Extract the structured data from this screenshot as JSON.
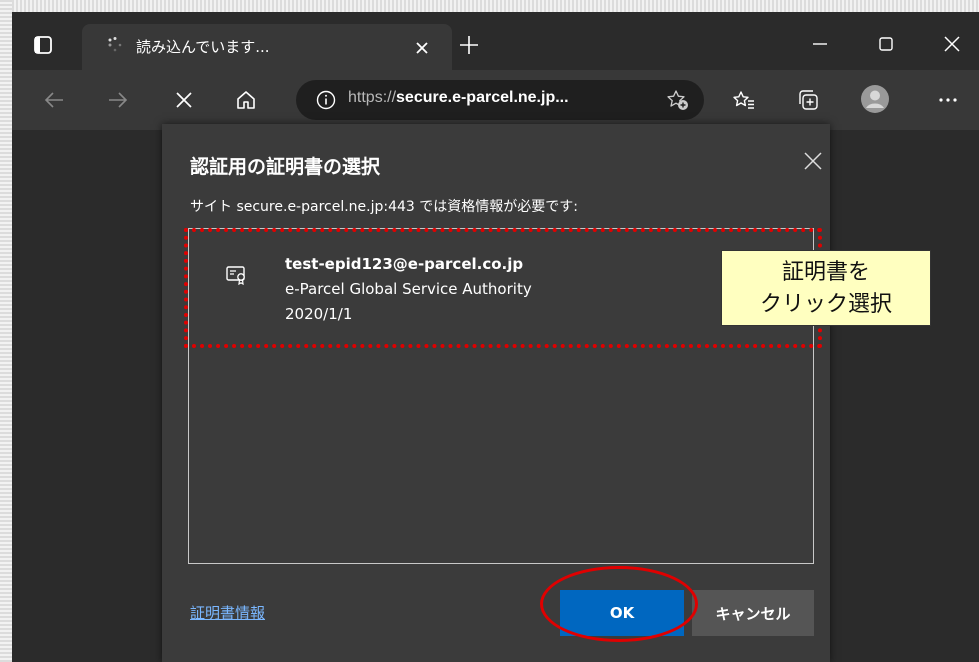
{
  "tab": {
    "title": "読み込んでいます..."
  },
  "address_bar": {
    "scheme": "https://",
    "host": "secure.e-parcel.ne.jp..."
  },
  "dialog": {
    "title": "認証用の証明書の選択",
    "message": "サイト secure.e-parcel.ne.jp:443 では資格情報が必要です:",
    "certificates": [
      {
        "name": "test-epid123@e-parcel.co.jp",
        "issuer": "e-Parcel Global Service Authority",
        "date": "2020/1/1"
      }
    ],
    "cert_info_link": "証明書情報",
    "ok_label": "OK",
    "cancel_label": "キャンセル"
  },
  "annotation": {
    "callout_line1": "証明書を",
    "callout_line2": "クリック選択"
  },
  "icons": {
    "tab_actions": "tab-actions-icon",
    "spinner": "loading-icon",
    "tab_close": "close-icon",
    "new_tab": "plus-icon",
    "minimize": "minimize-icon",
    "maximize": "maximize-icon",
    "window_close": "close-icon",
    "back": "arrow-left-icon",
    "forward": "arrow-right-icon",
    "stop": "stop-icon",
    "home": "home-icon",
    "info": "info-icon",
    "add_favorite": "star-add-icon",
    "favorites": "favorites-icon",
    "collections": "collections-icon",
    "profile": "profile-icon",
    "more": "more-icon",
    "certificate": "certificate-icon"
  },
  "colors": {
    "ok_button": "#0067c0",
    "annotation_red": "#e00000",
    "callout_bg": "#ffffc0",
    "link": "#7ab7ff"
  }
}
